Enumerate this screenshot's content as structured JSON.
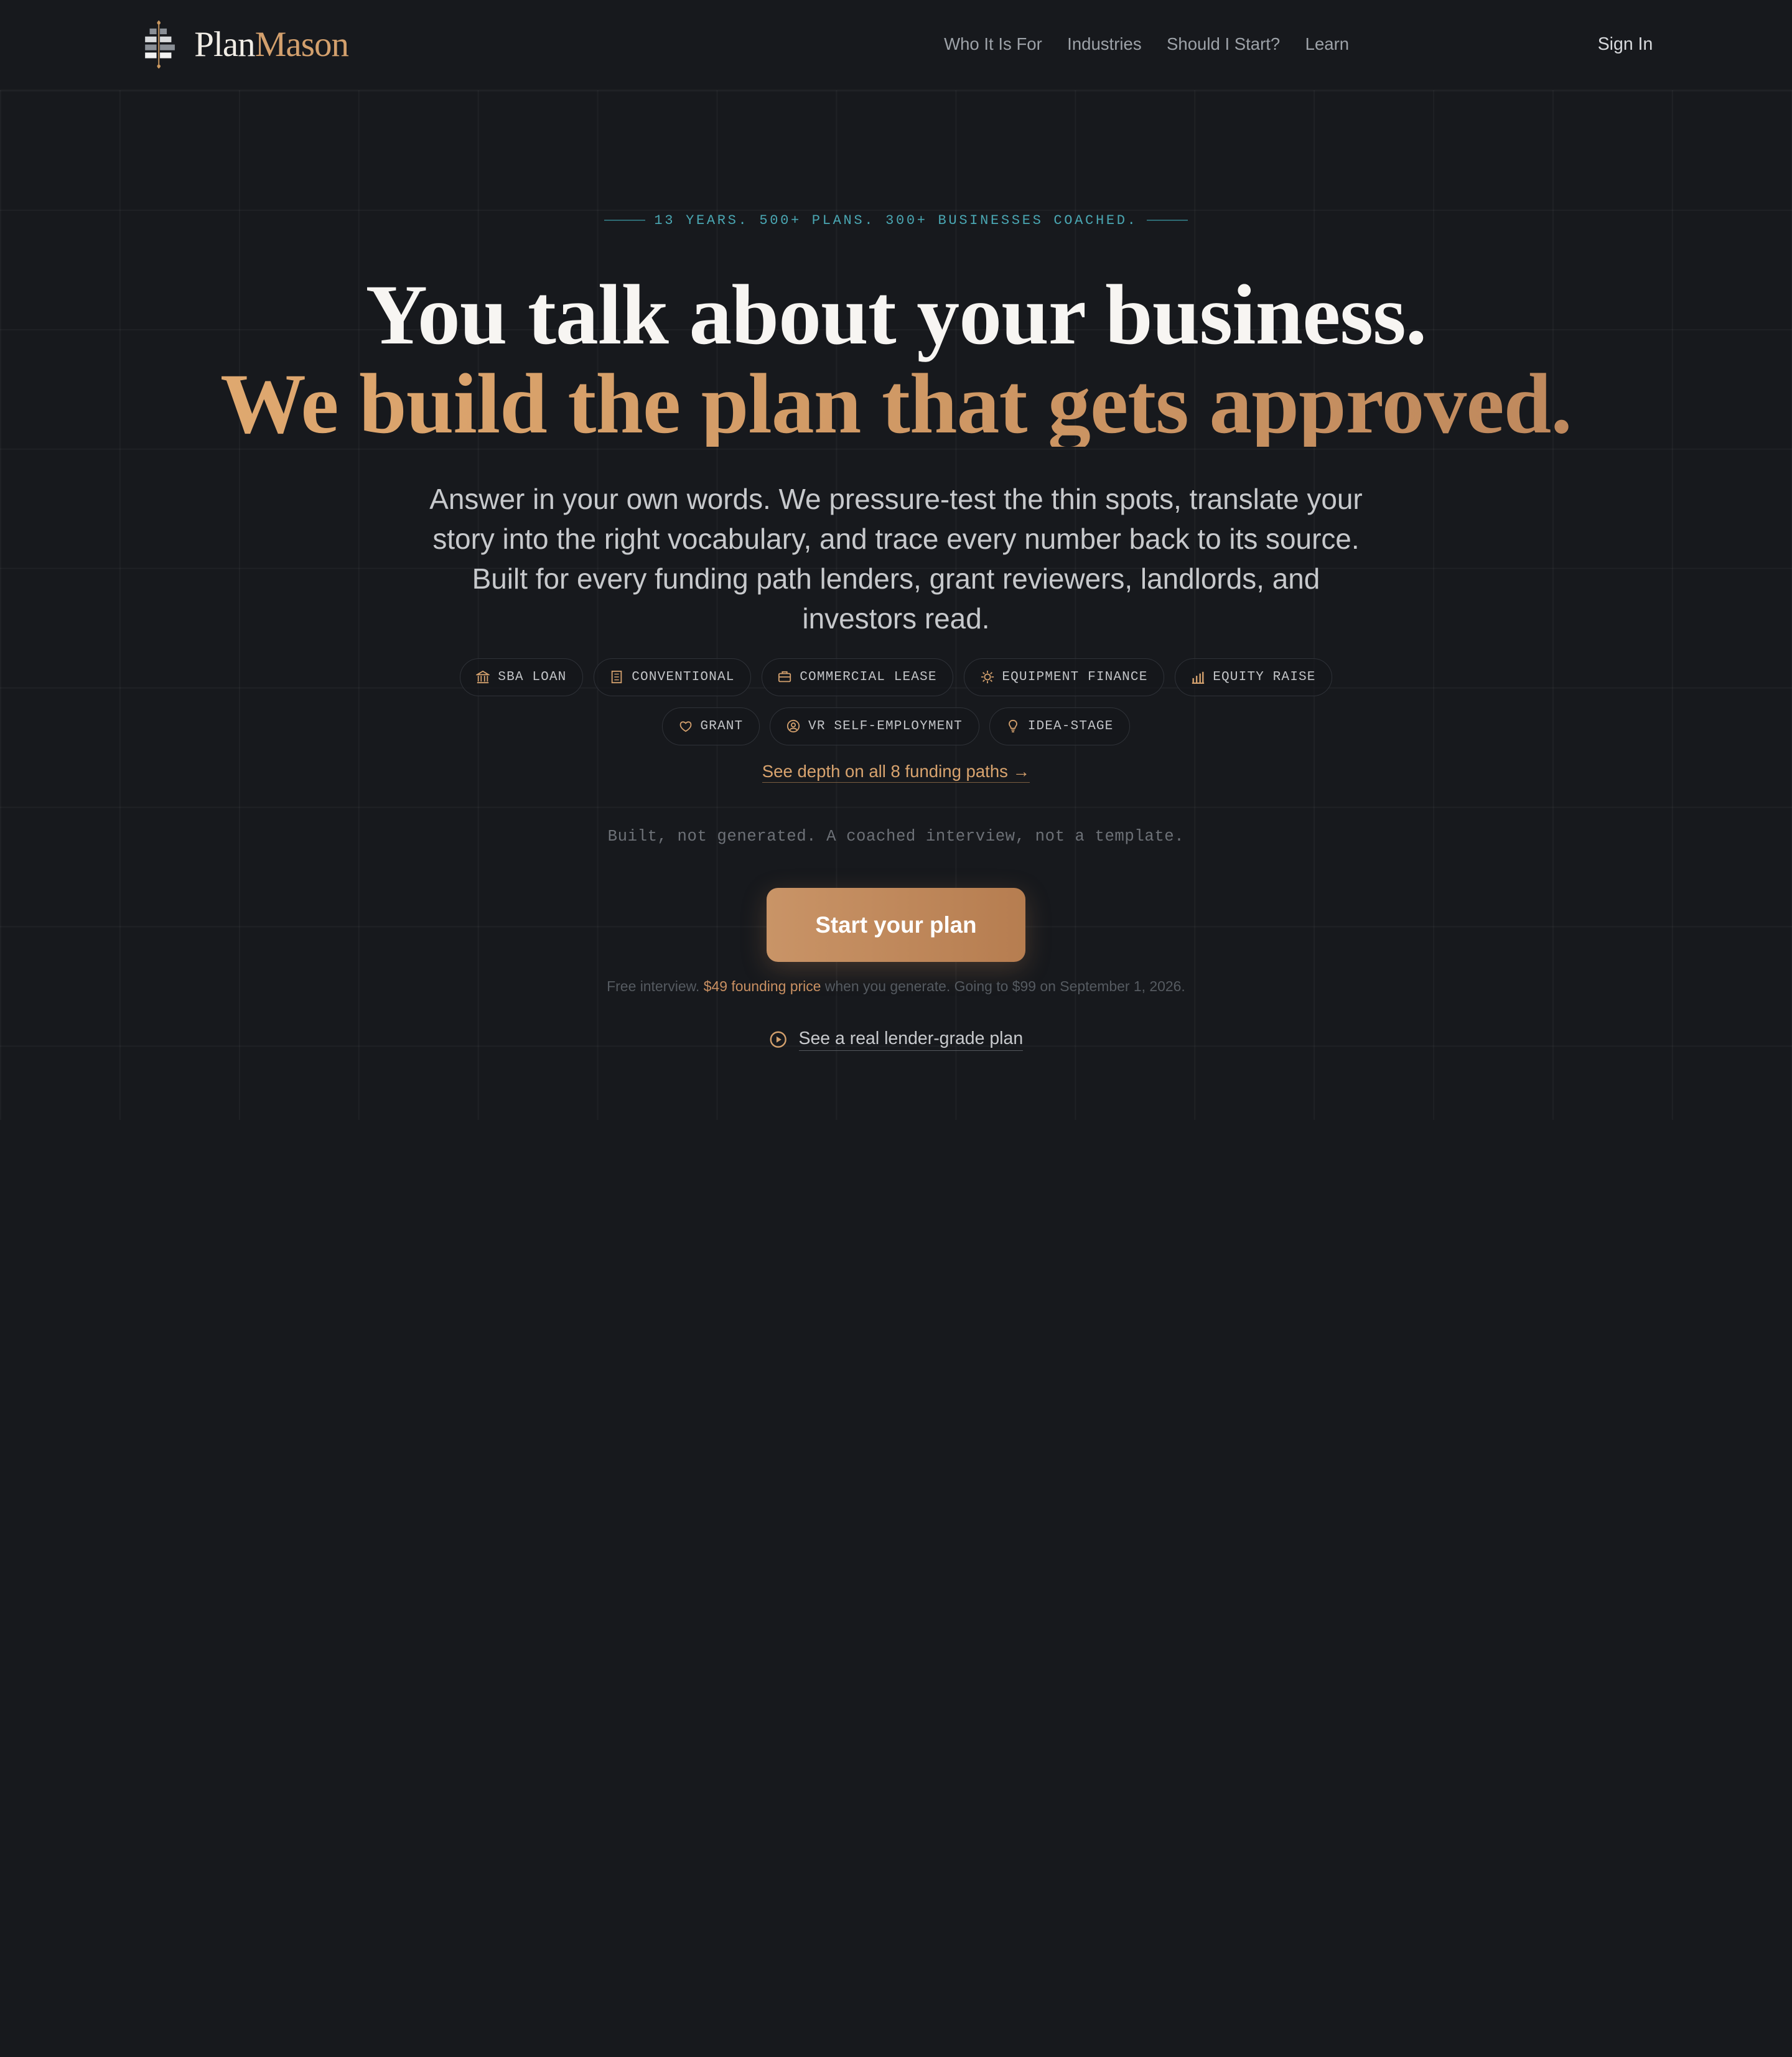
{
  "nav": {
    "brand_part1": "Plan",
    "brand_part2": "Mason",
    "links": [
      "Who It Is For",
      "Industries",
      "Should I Start?",
      "Learn"
    ],
    "sign_in": "Sign In"
  },
  "hero": {
    "eyebrow": "13 YEARS. 500+ PLANS. 300+ BUSINESSES COACHED.",
    "headline_line1": "You talk about your business.",
    "headline_line2": "We build the plan that gets approved.",
    "lede": "Answer in your own words. We pressure-test the thin spots, translate your story into the right vocabulary, and trace every number back to its source. Built for every funding path lenders, grant reviewers, landlords, and investors read.",
    "chips_row1": [
      {
        "icon": "bank-icon",
        "label": "SBA LOAN"
      },
      {
        "icon": "building-icon",
        "label": "CONVENTIONAL"
      },
      {
        "icon": "storefront-icon",
        "label": "COMMERCIAL LEASE"
      },
      {
        "icon": "gear-icon",
        "label": "EQUIPMENT FINANCE"
      },
      {
        "icon": "bar-chart-icon",
        "label": "EQUITY RAISE"
      }
    ],
    "chips_row2": [
      {
        "icon": "shield-heart-icon",
        "label": "GRANT"
      },
      {
        "icon": "user-circle-icon",
        "label": "VR SELF-EMPLOYMENT"
      },
      {
        "icon": "lightbulb-icon",
        "label": "IDEA-STAGE"
      }
    ],
    "depth_link": "See depth on all 8 funding paths →",
    "tagline": "Built, not generated. A coached interview, not a template.",
    "cta": "Start your plan",
    "price_pre": "Free interview. ",
    "price_highlight": "$49 founding price",
    "price_post": " when you generate. Going to $99 on September 1, 2026.",
    "sample_link": "See a real lender-grade plan"
  },
  "colors": {
    "background": "#17191d",
    "accent": "#d3a06d",
    "eyebrow": "#4aa7b3"
  }
}
